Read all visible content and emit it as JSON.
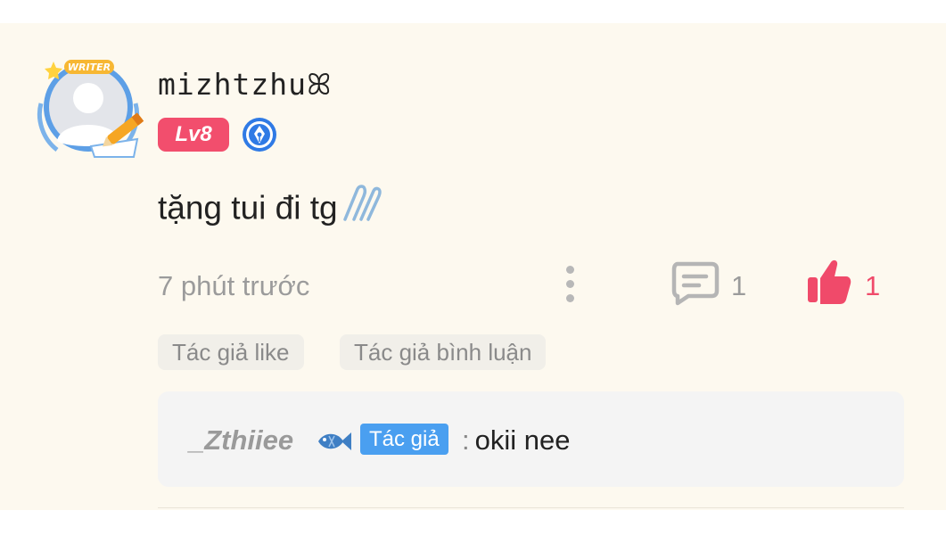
{
  "comment": {
    "username": "mizhtzhu",
    "username_symbol": "ꕤ",
    "level": "Lv8",
    "avatar_badge_text": "WRITER",
    "text": "tặng tui đi tg",
    "text_emoji_icon": "paperclip-icon",
    "time": "7 phút trước",
    "comment_count": "1",
    "like_count": "1",
    "tags": [
      "Tác giả like",
      "Tác giả bình luận"
    ]
  },
  "reply": {
    "author": "_Zthiiee",
    "author_emoji_icon": "fish-icon",
    "badge": "Tác giả",
    "separator": ":",
    "text": "okii nee"
  },
  "colors": {
    "card_background": "#fdf9ef",
    "level_badge": "#f24e6d",
    "like_active": "#f04a6a",
    "author_badge": "#4a9ff0",
    "muted_text": "#9b9b9b"
  }
}
